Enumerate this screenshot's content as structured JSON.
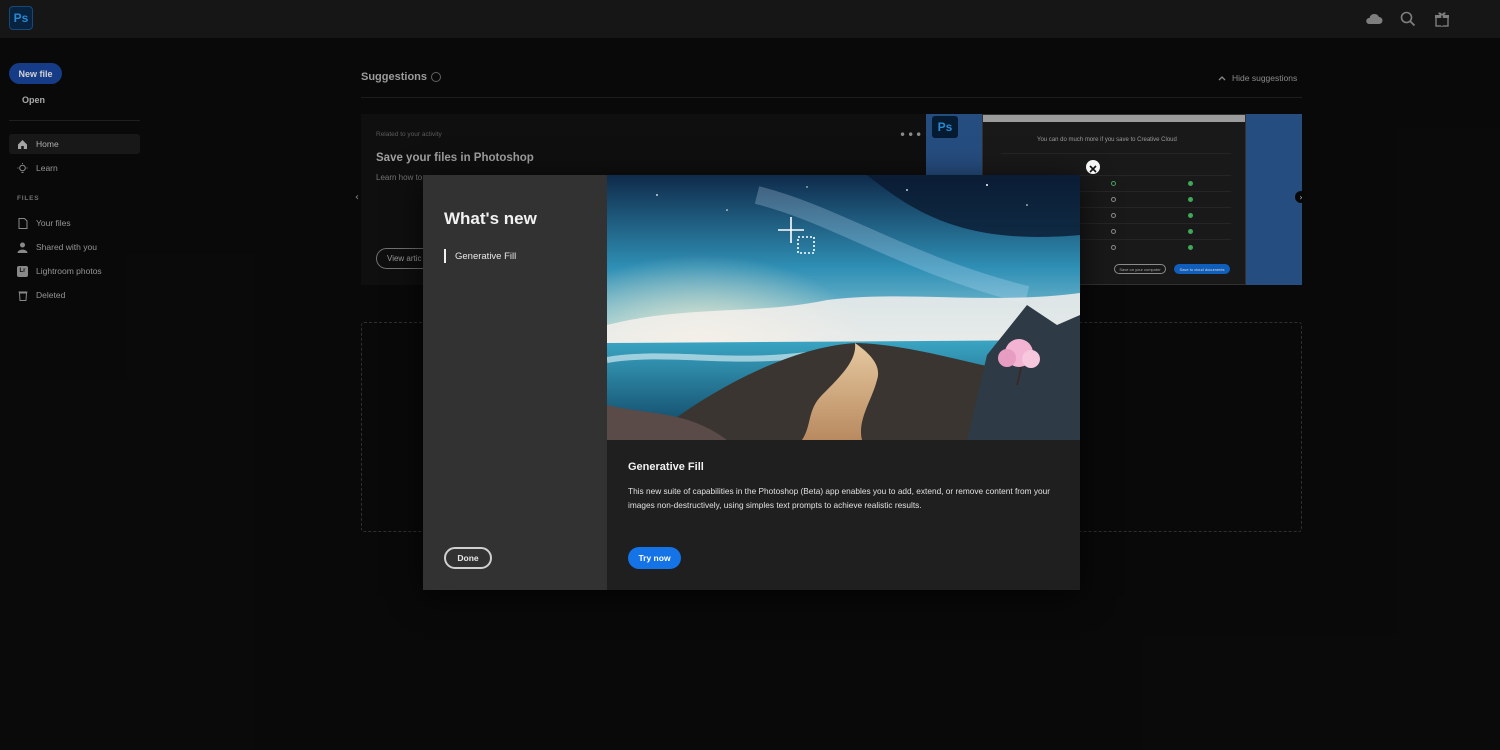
{
  "app": {
    "logo_text": "Ps"
  },
  "topbar": {
    "icons": [
      "cloud-icon",
      "search-icon",
      "gift-icon"
    ]
  },
  "sidebar": {
    "new_file_label": "New file",
    "open_label": "Open",
    "nav": [
      {
        "label": "Home",
        "icon": "home-icon",
        "active": true
      },
      {
        "label": "Learn",
        "icon": "lightbulb-icon",
        "active": false
      }
    ],
    "files_section_label": "FILES",
    "files": [
      {
        "label": "Your files",
        "icon": "document-icon"
      },
      {
        "label": "Shared with you",
        "icon": "person-icon"
      },
      {
        "label": "Lightroom photos",
        "icon": "lightroom-icon",
        "icon_text": "Lr"
      },
      {
        "label": "Deleted",
        "icon": "trash-icon"
      }
    ]
  },
  "suggestions": {
    "title": "Suggestions",
    "hide_label": "Hide suggestions",
    "card": {
      "related": "Related to your activity",
      "title": "Save your files in Photoshop",
      "learn": "Learn how to",
      "more": "•••",
      "view_article": "View artic"
    },
    "preview": {
      "ps_text": "Ps",
      "text": "You can do much more if you save to Creative Cloud",
      "btn_computer": "Save on your computer",
      "btn_cloud": "Save to cloud documents"
    }
  },
  "modal": {
    "heading": "What's new",
    "nav_item": "Generative Fill",
    "done_label": "Done",
    "feature_title": "Generative Fill",
    "feature_desc": "This new suite of capabilities in the Photoshop (Beta) app enables you to add, extend, or remove content from your images non-destructively, using simples text prompts to achieve realistic results.",
    "try_label": "Try now"
  },
  "colors": {
    "accent": "#1473e6",
    "new_file_bg": "#1c4aa6",
    "ps_blue": "#31a8ff"
  }
}
